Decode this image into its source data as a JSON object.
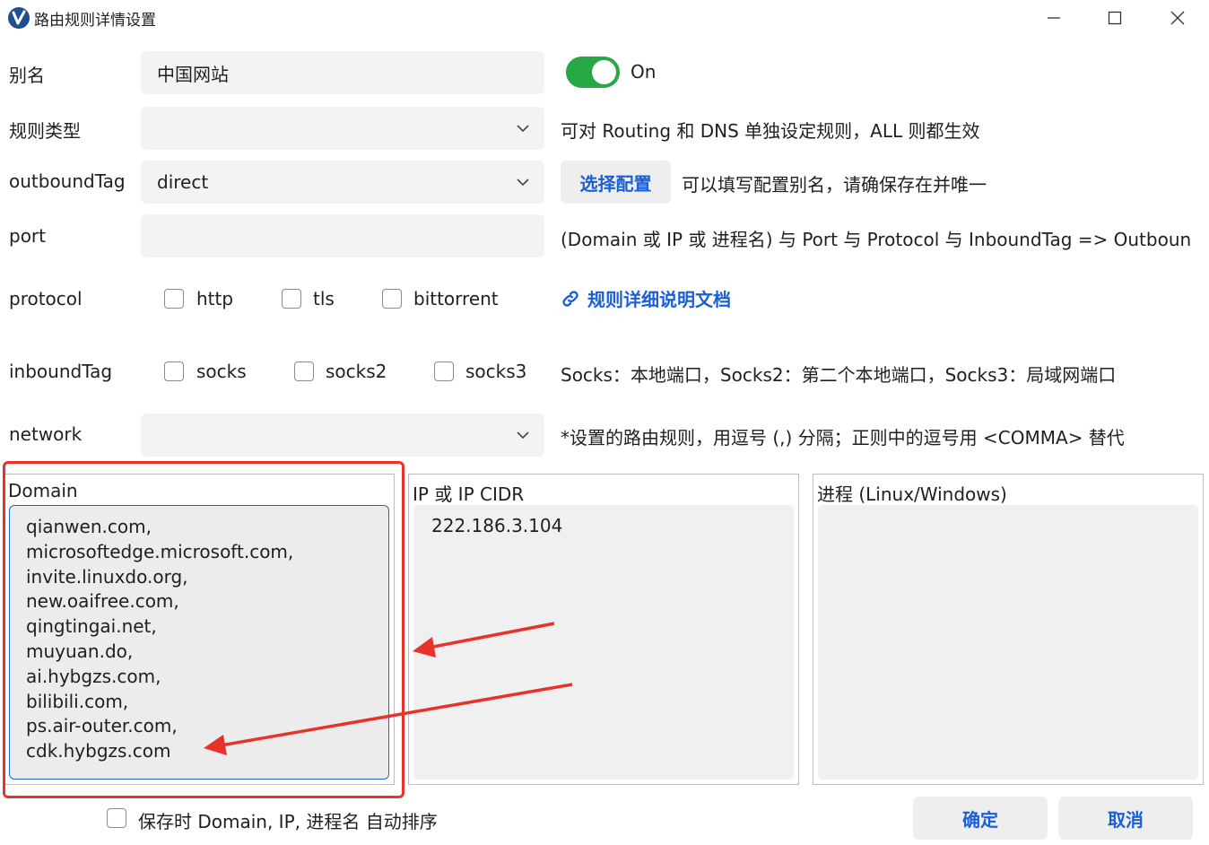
{
  "window": {
    "title": "路由规则详情设置",
    "app_icon": "v-logo-icon",
    "controls": [
      "minimize-icon",
      "maximize-icon",
      "close-icon"
    ]
  },
  "form": {
    "alias": {
      "label": "别名",
      "value": "中国网站"
    },
    "enabled": {
      "state": "On"
    },
    "rule_type": {
      "label": "规则类型",
      "value": "",
      "hint": "可对 Routing 和 DNS 单独设定规则，ALL 则都生效"
    },
    "outbound_tag": {
      "label": "outboundTag",
      "value": "direct",
      "select_button": "选择配置",
      "hint": "可以填写配置别名，请确保存在并唯一"
    },
    "port": {
      "label": "port",
      "value": "",
      "hint": "(Domain 或 IP 或 进程名) 与 Port 与 Protocol 与 InboundTag => Outboun"
    },
    "protocol": {
      "label": "protocol",
      "options": [
        "http",
        "tls",
        "bittorrent"
      ]
    },
    "doc_link": {
      "text": "规则详细说明文档",
      "icon": "link-icon"
    },
    "inbound_tag": {
      "label": "inboundTag",
      "options": [
        "socks",
        "socks2",
        "socks3"
      ],
      "hint": "Socks：本地端口，Socks2：第二个本地端口，Socks3：局域网端口"
    },
    "network": {
      "label": "network",
      "value": "",
      "hint": "*设置的路由规则，用逗号 (,) 分隔；正则中的逗号用 <COMMA> 替代"
    }
  },
  "panes": {
    "domain": {
      "title": "Domain",
      "lines": [
        "qianwen.com,",
        "microsoftedge.microsoft.com,",
        "invite.linuxdo.org,",
        "new.oaifree.com,",
        "qingtingai.net,",
        "muyuan.do,",
        "ai.hybgzs.com,",
        "bilibili.com,",
        "ps.air-outer.com,",
        "cdk.hybgzs.com"
      ]
    },
    "ip": {
      "title": "IP 或 IP CIDR",
      "text": "222.186.3.104"
    },
    "process": {
      "title": "进程 (Linux/Windows)",
      "text": ""
    }
  },
  "footer": {
    "auto_sort_label": "保存时 Domain, IP, 进程名 自动排序",
    "ok_label": "确定",
    "cancel_label": "取消"
  },
  "colors": {
    "accent_blue": "#1a5fd6",
    "toggle_green": "#27a844",
    "annotation_red": "#e8332a",
    "field_bg": "#f3f3f3"
  }
}
